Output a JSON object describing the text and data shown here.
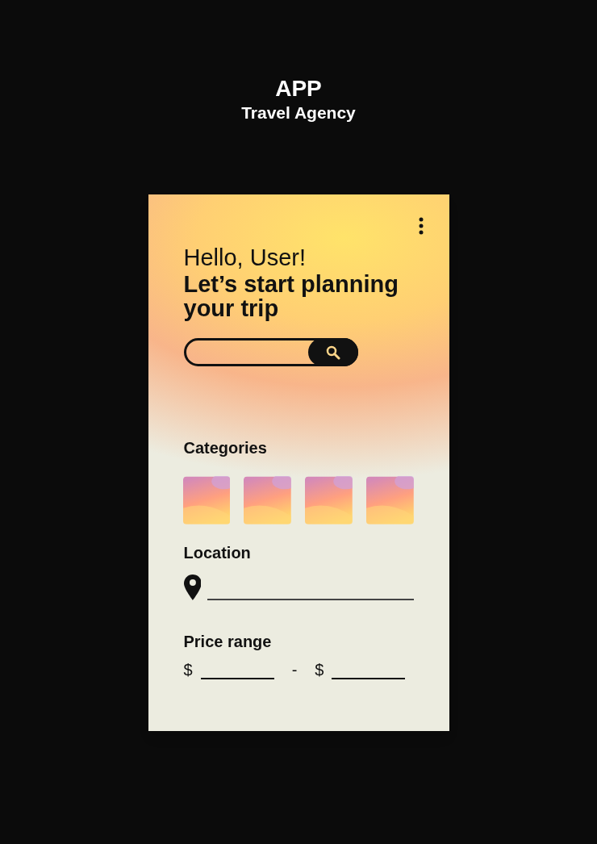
{
  "poster": {
    "title": "APP",
    "subtitle": "Travel Agency"
  },
  "screen": {
    "greeting": "Hello, User!",
    "headline": "Let’s start planning your trip",
    "categories": {
      "title": "Categories"
    },
    "location": {
      "title": "Location"
    },
    "price_range": {
      "title": "Price range",
      "min_currency": "$",
      "separator": "-",
      "max_currency": "$"
    }
  }
}
